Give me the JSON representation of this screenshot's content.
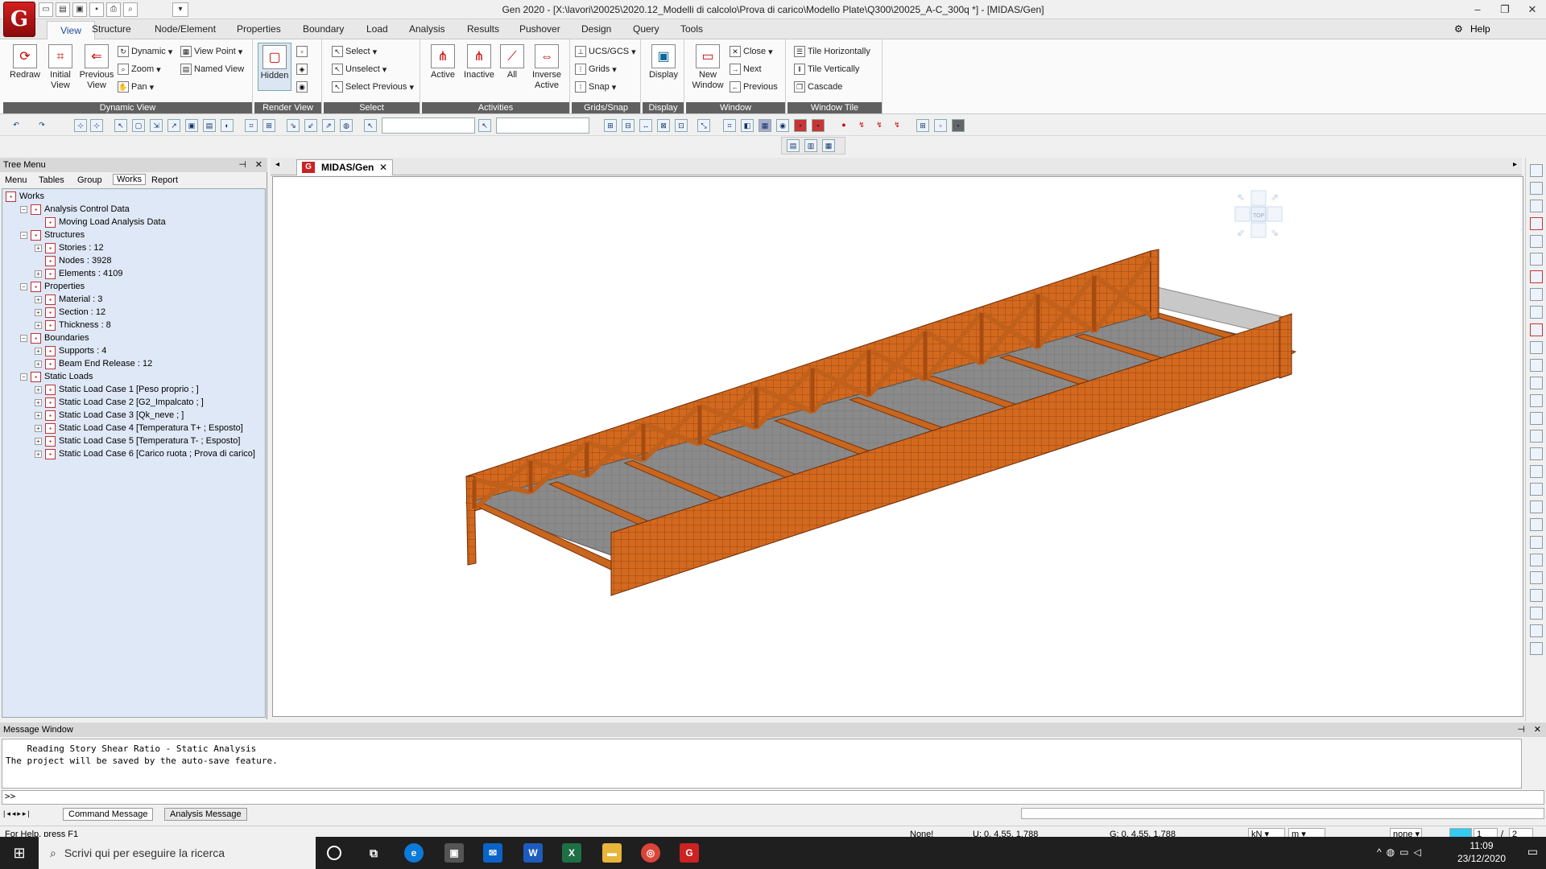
{
  "window": {
    "title": "Gen 2020 - [X:\\lavori\\20025\\2020.12_Modelli di calcolo\\Prova di carico\\Modello Plate\\Q300\\20025_A-C_300q *] - [MIDAS/Gen]",
    "logo": "G",
    "minimize": "–",
    "restore": "❐",
    "close": "✕"
  },
  "menu": {
    "tabs": [
      "View",
      "Structure",
      "Node/Element",
      "Properties",
      "Boundary",
      "Load",
      "Analysis",
      "Results",
      "Pushover",
      "Design",
      "Query",
      "Tools"
    ],
    "help": "Help"
  },
  "ribbon": {
    "dynamic_view": {
      "label": "Dynamic View",
      "redraw": "Redraw",
      "initial_view": "Initial View",
      "previous_view": "Previous View",
      "dynamic": "Dynamic",
      "zoom": "Zoom",
      "pan": "Pan",
      "view_point": "View Point",
      "named_view": "Named View"
    },
    "render_view": {
      "label": "Render View",
      "hidden": "Hidden"
    },
    "select": {
      "label": "Select",
      "select": "Select",
      "unselect": "Unselect",
      "select_previous": "Select Previous"
    },
    "activities": {
      "label": "Activities",
      "active": "Active",
      "inactive": "Inactive",
      "all": "All",
      "inverse_active": "Inverse Active"
    },
    "grids_snap": {
      "label": "Grids/Snap",
      "ucs": "UCS/GCS",
      "grids": "Grids",
      "snap": "Snap"
    },
    "display": {
      "label": "Display",
      "display": "Display"
    },
    "window": {
      "label": "Window",
      "new_window": "New Window",
      "close": "Close",
      "next": "Next",
      "previous": "Previous"
    },
    "window_tile": {
      "label": "Window Tile",
      "tile_h": "Tile Horizontally",
      "tile_v": "Tile Vertically",
      "cascade": "Cascade"
    }
  },
  "tree": {
    "title": "Tree Menu",
    "tabs": [
      "Menu",
      "Tables",
      "Group",
      "Works",
      "Report"
    ],
    "active_tab": "Works",
    "nodes": [
      {
        "label": "Works",
        "level": 0
      },
      {
        "label": "Analysis Control Data",
        "level": 1
      },
      {
        "label": "Moving Load Analysis Data",
        "level": 2
      },
      {
        "label": "Structures",
        "level": 1
      },
      {
        "label": "Stories : 12",
        "level": 2
      },
      {
        "label": "Nodes : 3928",
        "level": 2
      },
      {
        "label": "Elements : 4109",
        "level": 2
      },
      {
        "label": "Properties",
        "level": 1
      },
      {
        "label": "Material : 3",
        "level": 2
      },
      {
        "label": "Section : 12",
        "level": 2
      },
      {
        "label": "Thickness : 8",
        "level": 2
      },
      {
        "label": "Boundaries",
        "level": 1
      },
      {
        "label": "Supports : 4",
        "level": 2
      },
      {
        "label": "Beam End Release : 12",
        "level": 2
      },
      {
        "label": "Static Loads",
        "level": 1
      },
      {
        "label": "Static Load Case 1 [Peso proprio ; ]",
        "level": 2
      },
      {
        "label": "Static Load Case 2 [G2_Impalcato ; ]",
        "level": 2
      },
      {
        "label": "Static Load Case 3 [Qk_neve ; ]",
        "level": 2
      },
      {
        "label": "Static Load Case 4 [Temperatura T+ ; Esposto]",
        "level": 2
      },
      {
        "label": "Static Load Case 5 [Temperatura T- ; Esposto]",
        "level": 2
      },
      {
        "label": "Static Load Case 6 [Carico ruota ; Prova di carico]",
        "level": 2
      }
    ]
  },
  "document": {
    "tab": "MIDAS/Gen",
    "view_cube_top": "TOP"
  },
  "messages": {
    "title": "Message Window",
    "body": "    Reading Story Shear Ratio - Static Analysis\nThe project will be saved by the auto-save feature.",
    "prompt": ">>",
    "tabs": [
      "Command Message",
      "Analysis Message"
    ]
  },
  "status": {
    "help": "For Help, press F1",
    "selection": "None!",
    "ucs_coord": "U: 0, 4.55, 1.788",
    "gcs_coord": "G: 0, 4.55, 1.788",
    "force_unit": "kN",
    "length_unit": "m",
    "none_label": "none",
    "page_current": "1",
    "page_total": "2"
  },
  "taskbar": {
    "search_placeholder": "Scrivi qui per eseguire la ricerca",
    "time": "11:09",
    "date": "23/12/2020"
  },
  "colors": {
    "truss": "#d2691e",
    "truss_dark": "#8b3a0f",
    "deck": "#808080",
    "accent": "#1a4a9a"
  }
}
